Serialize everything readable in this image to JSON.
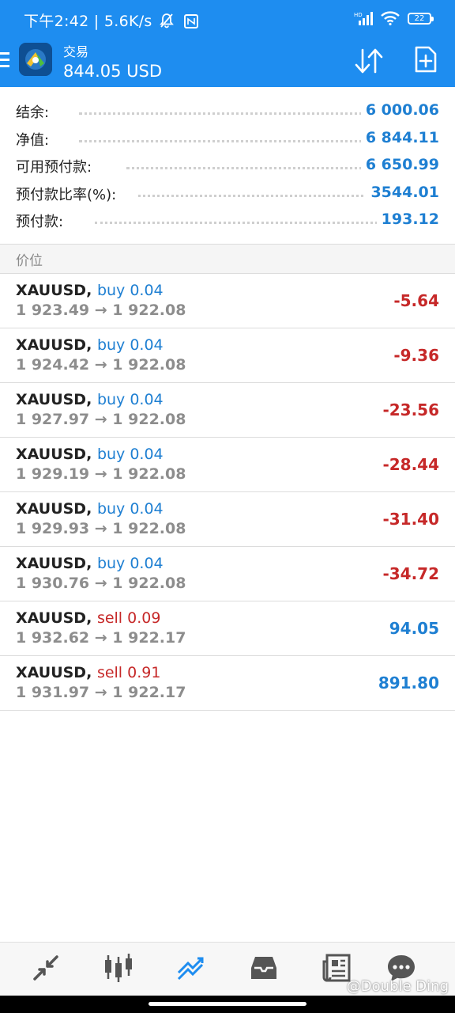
{
  "status_bar": {
    "left_text": "下午2:42 | 5.6K/s",
    "network_label": "HD",
    "battery": "22"
  },
  "app_bar": {
    "title": "交易",
    "balance": "844.05 USD"
  },
  "summary": [
    {
      "label": "结余:",
      "value": "6 000.06"
    },
    {
      "label": "净值:",
      "value": "6 844.11"
    },
    {
      "label": "可用预付款:",
      "value": "6 650.99"
    },
    {
      "label": "预付款比率(%):",
      "value": "3544.01"
    },
    {
      "label": "预付款:",
      "value": "193.12"
    }
  ],
  "section_title": "价位",
  "positions": [
    {
      "symbol": "XAUUSD,",
      "side": "buy",
      "volume": "buy 0.04",
      "prices": "1 923.49 → 1 922.08",
      "pl": "-5.64"
    },
    {
      "symbol": "XAUUSD,",
      "side": "buy",
      "volume": "buy 0.04",
      "prices": "1 924.42 → 1 922.08",
      "pl": "-9.36"
    },
    {
      "symbol": "XAUUSD,",
      "side": "buy",
      "volume": "buy 0.04",
      "prices": "1 927.97 → 1 922.08",
      "pl": "-23.56"
    },
    {
      "symbol": "XAUUSD,",
      "side": "buy",
      "volume": "buy 0.04",
      "prices": "1 929.19 → 1 922.08",
      "pl": "-28.44"
    },
    {
      "symbol": "XAUUSD,",
      "side": "buy",
      "volume": "buy 0.04",
      "prices": "1 929.93 → 1 922.08",
      "pl": "-31.40"
    },
    {
      "symbol": "XAUUSD,",
      "side": "buy",
      "volume": "buy 0.04",
      "prices": "1 930.76 → 1 922.08",
      "pl": "-34.72"
    },
    {
      "symbol": "XAUUSD,",
      "side": "sell",
      "volume": "sell 0.09",
      "prices": "1 932.62 → 1 922.17",
      "pl": "94.05"
    },
    {
      "symbol": "XAUUSD,",
      "side": "sell",
      "volume": "sell 0.91",
      "prices": "1 931.97 → 1 922.17",
      "pl": "891.80"
    }
  ],
  "bottom_nav": [
    {
      "name": "quotes-icon",
      "active": false
    },
    {
      "name": "chart-icon",
      "active": false
    },
    {
      "name": "trade-icon",
      "active": true
    },
    {
      "name": "history-icon",
      "active": false
    },
    {
      "name": "news-icon",
      "active": false
    },
    {
      "name": "chat-icon",
      "active": false
    }
  ],
  "watermark": "@Double Ding",
  "colors": {
    "primary": "#1e8df0",
    "profit": "#1e7fd2",
    "loss": "#c62828"
  }
}
